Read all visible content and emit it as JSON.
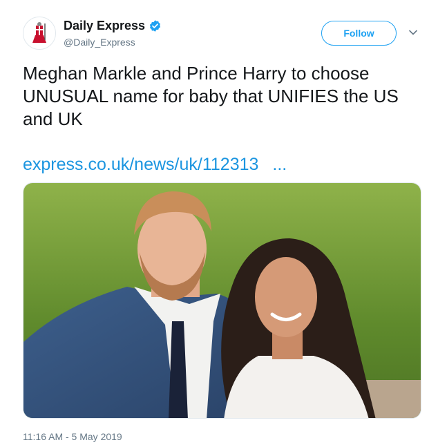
{
  "account": {
    "name": "Daily Express",
    "handle": "@Daily_Express",
    "verified": true,
    "avatar_icon": "crusader-knight-logo"
  },
  "actions": {
    "follow_label": "Follow",
    "menu_icon": "chevron-down-icon"
  },
  "tweet": {
    "text": "Meghan Markle and Prince Harry to choose UNUSUAL name for baby that UNIFIES the US and UK",
    "link_text": "express.co.uk/news/uk/112313",
    "link_ellipsis": "...",
    "image_alt": "photo of a red-haired bearded man in a blue suit and a smiling dark-haired woman in a white coat on a lawn",
    "timestamp": "11:16 AM - 5 May 2019"
  },
  "colors": {
    "accent": "#1da1f2",
    "link": "#1b95e0",
    "muted": "#657786",
    "logo_red": "#c8102e"
  }
}
